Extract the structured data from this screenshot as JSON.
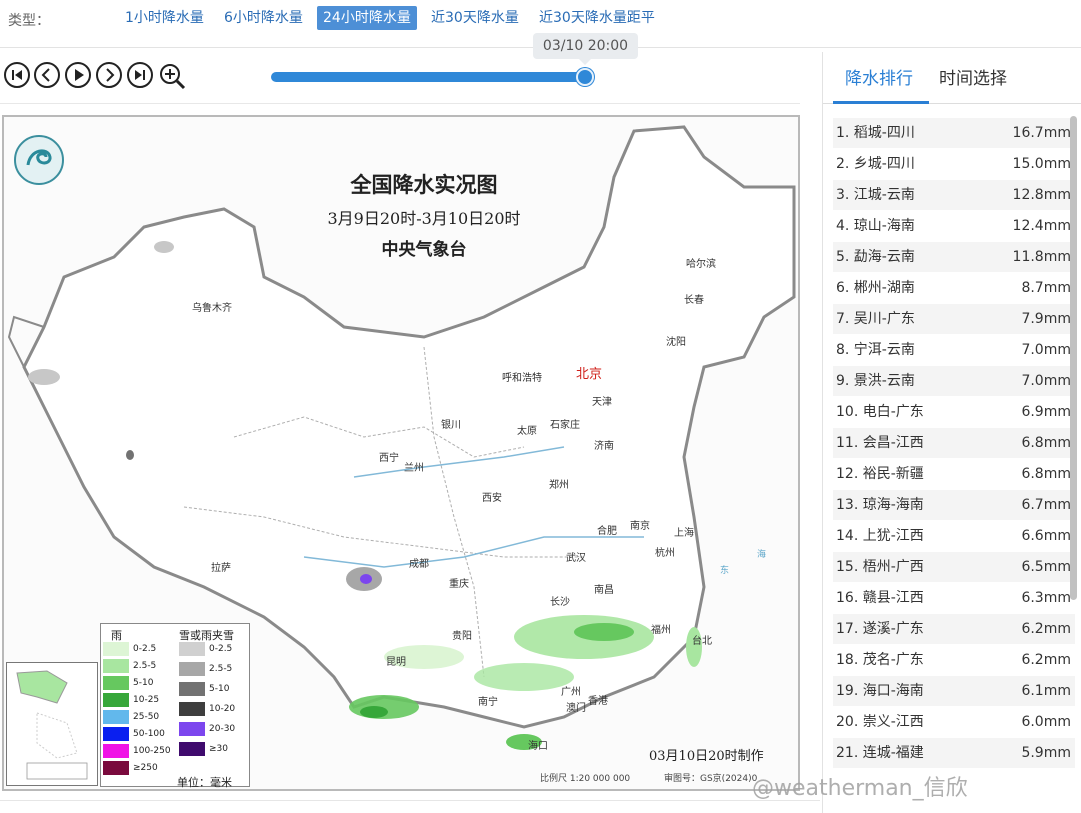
{
  "typebar": {
    "label": "类型：",
    "tabs": [
      {
        "label": "1小时降水量",
        "active": false
      },
      {
        "label": "6小时降水量",
        "active": false
      },
      {
        "label": "24小时降水量",
        "active": true
      },
      {
        "label": "近30天降水量",
        "active": false
      },
      {
        "label": "近30天降水量距平",
        "active": false
      }
    ]
  },
  "player": {
    "controls": [
      "skip-first-icon",
      "prev-icon",
      "play-icon",
      "next-icon",
      "skip-last-icon",
      "zoom-in-icon"
    ],
    "current_time": "03/10 20:00",
    "progress": 1.0
  },
  "map": {
    "title": "全国降水实况图",
    "subtitle": "3月9日20时-3月10日20时",
    "org": "中央气象台",
    "made": "03月10日20时制作",
    "scale": "比例尺 1:20 000 000",
    "review": "审图号：GS京(2024)0",
    "cities": {
      "urumqi": "乌鲁木齐",
      "harbin": "哈尔滨",
      "changchun": "长春",
      "shenyang": "沈阳",
      "hohhot": "呼和浩特",
      "beijing": "北京",
      "tianjin": "天津",
      "yinchuan": "银川",
      "taiyuan": "太原",
      "shijiazhuang": "石家庄",
      "jinan": "济南",
      "xining": "西宁",
      "lanzhou": "兰州",
      "zhengzhou": "郑州",
      "xian": "西安",
      "hefei": "合肥",
      "nanjing": "南京",
      "shanghai": "上海",
      "hangzhou": "杭州",
      "wuhan": "武汉",
      "lhasa": "拉萨",
      "chengdu": "成都",
      "chongqing": "重庆",
      "changsha": "长沙",
      "nanchang": "南昌",
      "fuzhou": "福州",
      "taibei": "台北",
      "guiyang": "贵阳",
      "kunming": "昆明",
      "nanning": "南宁",
      "guangzhou": "广州",
      "aomen": "澳门",
      "xianggang": "香港",
      "haikou": "海口"
    },
    "seas": {
      "east": "东",
      "sea": "海"
    },
    "legend": {
      "rain_header": "雨",
      "snow_header": "雪或雨夹雪",
      "rain": [
        {
          "label": "0-2.5",
          "color": "#ddf5d5"
        },
        {
          "label": "2.5-5",
          "color": "#a8e6a0"
        },
        {
          "label": "5-10",
          "color": "#66c85f"
        },
        {
          "label": "10-25",
          "color": "#37a73a"
        },
        {
          "label": "25-50",
          "color": "#62b8ec"
        },
        {
          "label": "50-100",
          "color": "#0a1ff0"
        },
        {
          "label": "100-250",
          "color": "#f012e6"
        },
        {
          "label": "≥250",
          "color": "#7a0a3d"
        }
      ],
      "snow": [
        {
          "label": "0-2.5",
          "color": "#d0d0d0"
        },
        {
          "label": "2.5-5",
          "color": "#a7a7a7"
        },
        {
          "label": "5-10",
          "color": "#727272"
        },
        {
          "label": "10-20",
          "color": "#3e3e3e"
        },
        {
          "label": "20-30",
          "color": "#7c46ee"
        },
        {
          "label": "≥30",
          "color": "#3f0a6d"
        }
      ],
      "unit": "单位：毫米"
    }
  },
  "panel": {
    "tabs": [
      {
        "label": "降水排行",
        "active": true
      },
      {
        "label": "时间选择",
        "active": false
      }
    ],
    "ranking": [
      {
        "name": "1. 稻城-四川",
        "value": "16.7mm"
      },
      {
        "name": "2. 乡城-四川",
        "value": "15.0mm"
      },
      {
        "name": "3. 江城-云南",
        "value": "12.8mm"
      },
      {
        "name": "4. 琼山-海南",
        "value": "12.4mm"
      },
      {
        "name": "5. 勐海-云南",
        "value": "11.8mm"
      },
      {
        "name": "6. 郴州-湖南",
        "value": "8.7mm"
      },
      {
        "name": "7. 吴川-广东",
        "value": "7.9mm"
      },
      {
        "name": "8. 宁洱-云南",
        "value": "7.0mm"
      },
      {
        "name": "9. 景洪-云南",
        "value": "7.0mm"
      },
      {
        "name": "10. 电白-广东",
        "value": "6.9mm"
      },
      {
        "name": "11. 会昌-江西",
        "value": "6.8mm"
      },
      {
        "name": "12. 裕民-新疆",
        "value": "6.8mm"
      },
      {
        "name": "13. 琼海-海南",
        "value": "6.7mm"
      },
      {
        "name": "14. 上犹-江西",
        "value": "6.6mm"
      },
      {
        "name": "15. 梧州-广西",
        "value": "6.5mm"
      },
      {
        "name": "16. 赣县-江西",
        "value": "6.3mm"
      },
      {
        "name": "17. 遂溪-广东",
        "value": "6.2mm"
      },
      {
        "name": "18. 茂名-广东",
        "value": "6.2mm"
      },
      {
        "name": "19. 海口-海南",
        "value": "6.1mm"
      },
      {
        "name": "20. 崇义-江西",
        "value": "6.0mm"
      },
      {
        "name": "21. 连城-福建",
        "value": "5.9mm"
      }
    ]
  },
  "watermark": "@weatherman_信欣"
}
